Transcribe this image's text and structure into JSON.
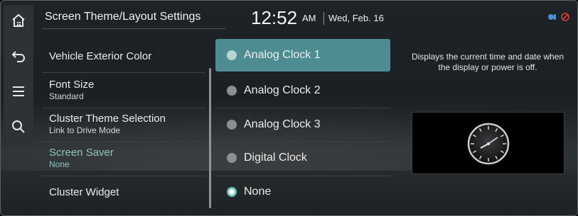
{
  "header": {
    "title": "Screen Theme/Layout Settings",
    "time": "12:52",
    "ampm": "AM",
    "date": "Wed, Feb. 16"
  },
  "rail": {
    "icons": [
      "home-icon",
      "back-icon",
      "menu-icon",
      "search-icon"
    ]
  },
  "settings": [
    {
      "label": "Vehicle Exterior Color",
      "sub": ""
    },
    {
      "label": "Font Size",
      "sub": "Standard"
    },
    {
      "label": "Cluster Theme Selection",
      "sub": "Link to Drive Mode"
    },
    {
      "label": "Screen Saver",
      "sub": "None",
      "active": true
    },
    {
      "label": "Cluster Widget",
      "sub": ""
    }
  ],
  "options": [
    {
      "label": "Analog Clock 1",
      "highlighted": true
    },
    {
      "label": "Analog Clock 2"
    },
    {
      "label": "Analog Clock 3"
    },
    {
      "label": "Digital Clock"
    },
    {
      "label": "None",
      "checked": true
    }
  ],
  "description": "Displays the current time and date when the display or power is off.",
  "colors": {
    "accent": "#4d8d92",
    "active_text": "#8fc6c2"
  }
}
